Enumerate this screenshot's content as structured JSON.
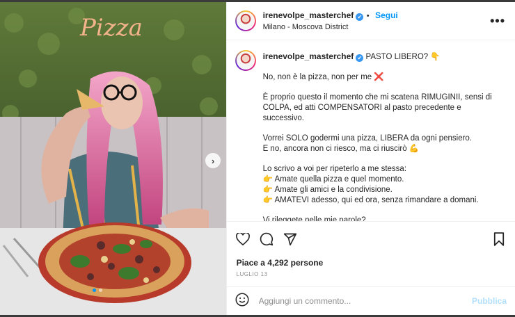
{
  "post": {
    "username": "irenevolpe_masterchef",
    "verified_glyph": "✔",
    "follow_label": "Segui",
    "location": "Milano - Moscova District",
    "more_label": "•••",
    "image_sign_text": "Pizza",
    "next_arrow_glyph": "›"
  },
  "caption": {
    "lead": "PASTO LIBERO? 👇",
    "paragraphs": [
      "No, non è la pizza, non per me ❌",
      "È proprio questo il momento che mi scatena RIMUGINII, sensi di COLPA, ed atti COMPENSATORI al pasto precedente e successivo.",
      "Vorrei SOLO godermi una pizza, LIBERA da ogni pensiero.\nE no, ancora non ci riesco, ma ci riuscirò 💪",
      "Lo scrivo a voi per ripeterlo a me stessa:\n👉 Amate quella pizza e quel momento.\n👉 Amate gli amici e la condivisione.\n👉 AMATEVI adesso, qui ed ora, senza rimandare a domani.",
      "Vi rileggete nelle mie parole?"
    ]
  },
  "actions": {
    "icons": [
      "heart-icon",
      "comment-icon",
      "share-icon",
      "bookmark-icon"
    ]
  },
  "likes_text": "Piace a 4,292 persone",
  "date": "LUGLIO 13",
  "comment": {
    "placeholder": "Aggiungi un commento...",
    "publish_label": "Pubblica"
  },
  "colors": {
    "accent": "#0095f6",
    "publish_disabled": "#b2dffc",
    "verified": "#3897f0"
  }
}
